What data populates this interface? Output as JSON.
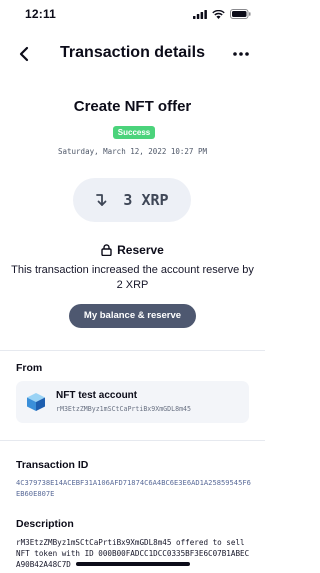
{
  "status_bar": {
    "time": "12:11"
  },
  "header": {
    "title": "Transaction details"
  },
  "transaction": {
    "type": "Create NFT offer",
    "status": "Success",
    "date": "Saturday, March 12, 2022 10:27 PM",
    "amount": "3 XRP"
  },
  "reserve": {
    "title": "Reserve",
    "description": "This transaction increased the account reserve by 2 XRP",
    "button_label": "My balance & reserve"
  },
  "from": {
    "label": "From",
    "account_name": "NFT test account",
    "account_address": "rM3EtzZMByz1mSCtCaPrtiBx9XmGDL8m45"
  },
  "transaction_id": {
    "label": "Transaction ID",
    "value": "4C379738E14ACEBF31A106AFD71874C6A4BC6E3E6AD1A25859545F6EB60E807E"
  },
  "description": {
    "label": "Description",
    "value": "rM3EtzZMByz1mSCtCaPrtiBx9XmGDL8m45 offered to sell NFT token with ID 000B00FADCC1DCC0335BF3E6C07B1ABECA90B42A48C7D"
  },
  "colors": {
    "success": "#4bd37b",
    "button": "#4e5870",
    "pill": "#edf0f6",
    "link": "#5a6b99"
  }
}
